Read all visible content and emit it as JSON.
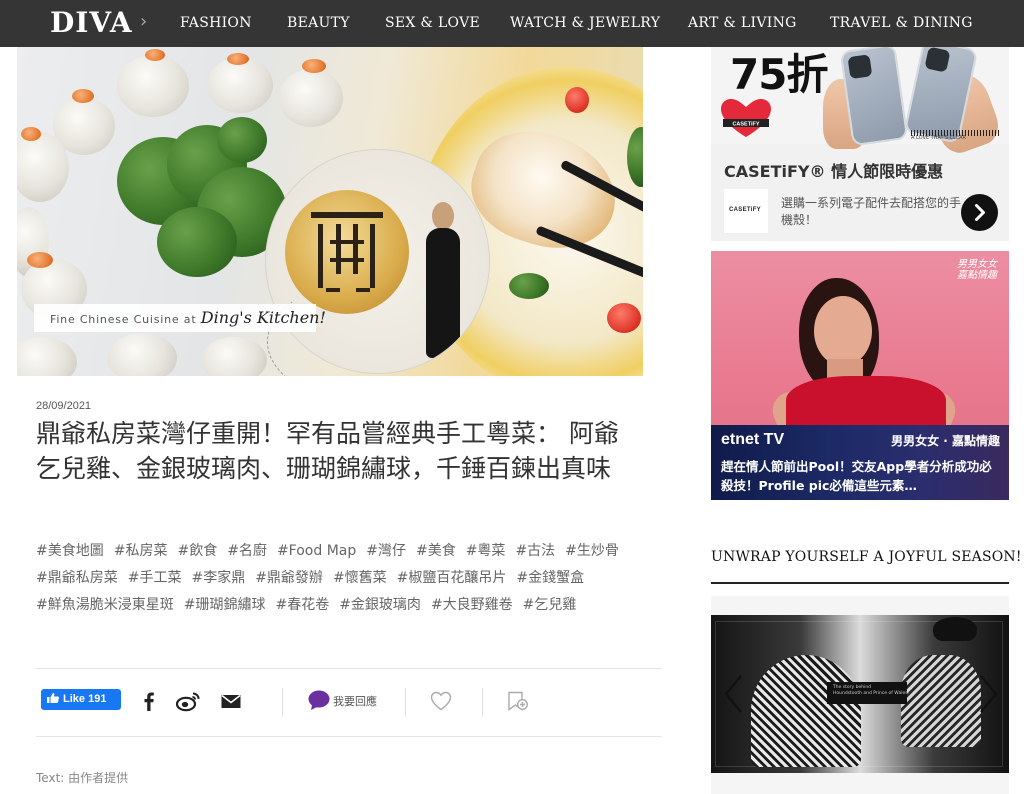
{
  "nav": {
    "logo": "DIVA",
    "items": [
      {
        "label": "FASHION"
      },
      {
        "label": "BEAUTY"
      },
      {
        "label": "SEX & LOVE"
      },
      {
        "label": "WATCH & JEWELRY"
      },
      {
        "label": "ART & LIVING"
      },
      {
        "label": "TRAVEL & DINING"
      }
    ]
  },
  "hero": {
    "tagline_prefix": "Fine Chinese Cuisine at",
    "tagline_script": "Ding's Kitchen!"
  },
  "article": {
    "date": "28/09/2021",
    "title": "鼎爺私房菜灣仔重開！罕有品嘗經典手工粵菜： 阿爺乞兒雞、金銀玻璃肉、珊瑚錦繡球，千錘百鍊出真味",
    "tags": [
      "#美食地圖",
      "#私房菜",
      "#飲食",
      "#名廚",
      "#Food Map",
      "#灣仔",
      "#美食",
      "#粵菜",
      "#古法",
      "#生炒骨",
      "#鼎爺私房菜",
      "#手工菜",
      "#李家鼎",
      "#鼎爺發辦",
      "#懷舊菜",
      "#椒鹽百花釀吊片",
      "#金錢蟹盒",
      "#鮮魚湯脆米浸東星斑",
      "#珊瑚錦繡球",
      "#春花卷",
      "#金銀玻璃肉",
      "#大良野雞卷",
      "#乞兒雞"
    ],
    "like_label": "Like",
    "like_count": "191",
    "reply_label": "我要回應",
    "credit": "Text: 由作者提供"
  },
  "ad1": {
    "headline": "75折",
    "barcode_text": "A LOVE THAT'S CLEAR",
    "title": "CASETiFY® 情人節限時優惠",
    "brand": "CASETiFY",
    "subtitle": "選購一系列電子配件去配搭您的手機殼！"
  },
  "ad2": {
    "corner_logo_line1": "男男女女",
    "corner_logo_line2": "嘉點情趣",
    "channel": "etnet TV",
    "show": "男男女女 · 嘉點情趣",
    "text": "趕在情人節前出Pool！交友App學者分析成功必殺技！Profile pic必備這些元素…"
  },
  "sidebar": {
    "section_title": "UNWRAP YOURSELF A JOYFUL SEASON!",
    "promo_label_line1": "The story behind",
    "promo_label_line2": "Houndstooth and Prince of Wales!"
  },
  "colors": {
    "nav_bg": "#353535",
    "facebook": "#1877f2",
    "reply_purple": "#6b2fa0",
    "ad2_pink": "#e9798f",
    "ad2_band": "#1c2a66"
  }
}
